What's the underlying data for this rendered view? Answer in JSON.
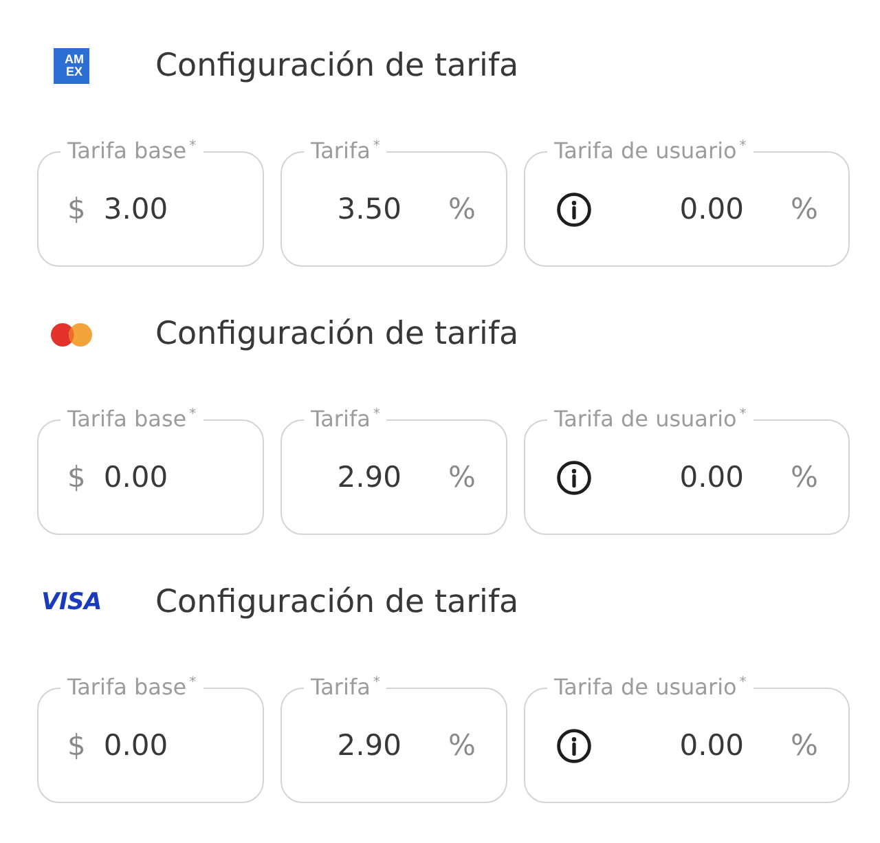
{
  "sections": [
    {
      "kind": "amex",
      "logo_text": "AM EX",
      "heading": "Configuración de tarifa",
      "fields": [
        {
          "label": "Tarifa base$^{*}$",
          "prefix": "$",
          "info_icon": false,
          "value": "3.00"
        },
        {
          "label": "Tarifa$^{*}$",
          "info_icon": false,
          "value": "3.50",
          "suffix": "%"
        },
        {
          "label": "Tarifa de usuario$^{*}$",
          "info_icon": true,
          "value": "0.00",
          "suffix": "%"
        }
      ]
    },
    {
      "kind": "mastercard",
      "heading": "Configuración de tarifa",
      "fields": [
        {
          "label": "Tarifa base$^{*}$",
          "prefix": "$",
          "info_icon": false,
          "value": "0.00"
        },
        {
          "label": "Tarifa$^{*}$",
          "info_icon": false,
          "value": "2.90",
          "suffix": "%"
        },
        {
          "label": "Tarifa de usuario$^{*}$",
          "info_icon": true,
          "value": "0.00",
          "suffix": "%"
        }
      ]
    },
    {
      "kind": "visa",
      "logo_text": "VISA",
      "heading": "Configuración de tarifa",
      "fields": [
        {
          "label": "Tarifa base$^{*}$",
          "prefix": "$",
          "info_icon": false,
          "value": "0.00"
        },
        {
          "label": "Tarifa$^{*}$",
          "info_icon": false,
          "value": "2.90",
          "suffix": "%"
        },
        {
          "label": "Tarifa de usuario$^{*}$",
          "info_icon": true,
          "value": "0.00",
          "suffix": "%"
        }
      ]
    }
  ]
}
